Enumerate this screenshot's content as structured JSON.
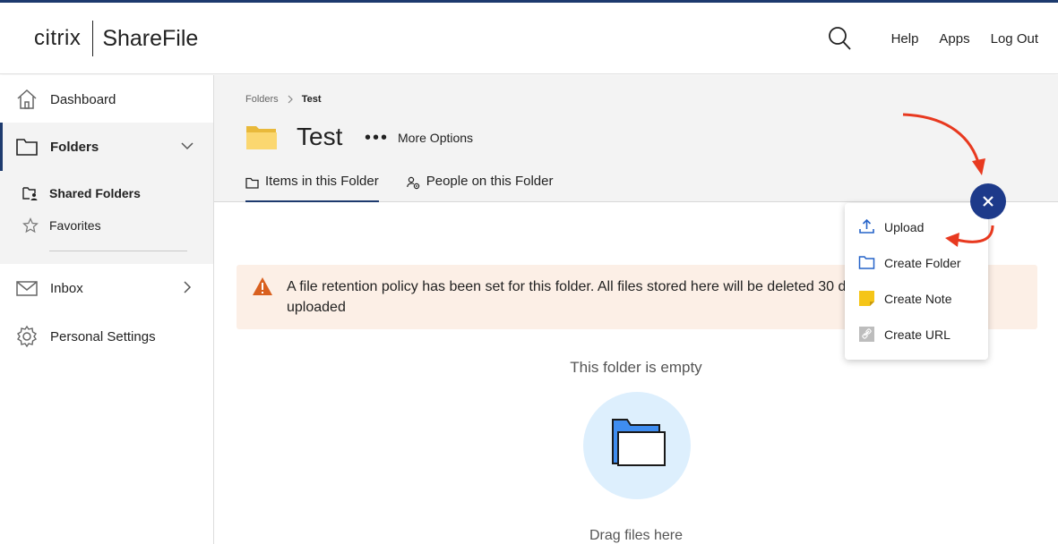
{
  "header": {
    "logo_brand": "citrix",
    "logo_product": "ShareFile",
    "links": [
      "Help",
      "Apps",
      "Log Out"
    ],
    "search_icon": "search-icon"
  },
  "sidebar": {
    "items": [
      {
        "label": "Dashboard",
        "icon": "home-icon"
      },
      {
        "label": "Folders",
        "icon": "folder-icon",
        "active": true
      },
      {
        "label": "Inbox",
        "icon": "mail-icon"
      },
      {
        "label": "Personal Settings",
        "icon": "gear-icon"
      }
    ],
    "subitems": [
      {
        "label": "Shared Folders",
        "icon": "shared-folders-icon",
        "active": true
      },
      {
        "label": "Favorites",
        "icon": "star-icon"
      }
    ]
  },
  "main": {
    "breadcrumb": {
      "root": "Folders",
      "current": "Test"
    },
    "folder_title": "Test",
    "more_options": "More Options",
    "tabs": [
      {
        "label": "Items in this Folder",
        "active": true
      },
      {
        "label": "People on this Folder"
      }
    ],
    "alert_text": "A file retention policy has been set for this folder. All files stored here will be deleted 30 days after they are uploaded",
    "empty_title": "This folder is empty",
    "drag_text": "Drag files here"
  },
  "menu": {
    "items": [
      {
        "label": "Upload",
        "icon": "upload-icon"
      },
      {
        "label": "Create Folder",
        "icon": "folder-outline-icon"
      },
      {
        "label": "Create Note",
        "icon": "note-icon"
      },
      {
        "label": "Create URL",
        "icon": "link-icon"
      }
    ]
  },
  "colors": {
    "brand_navy": "#1d3a6e",
    "fab_blue": "#1d3a8a",
    "alert_bg": "#fcefe6",
    "warning_orange": "#d9601f",
    "annotation_red": "#e8391f"
  }
}
